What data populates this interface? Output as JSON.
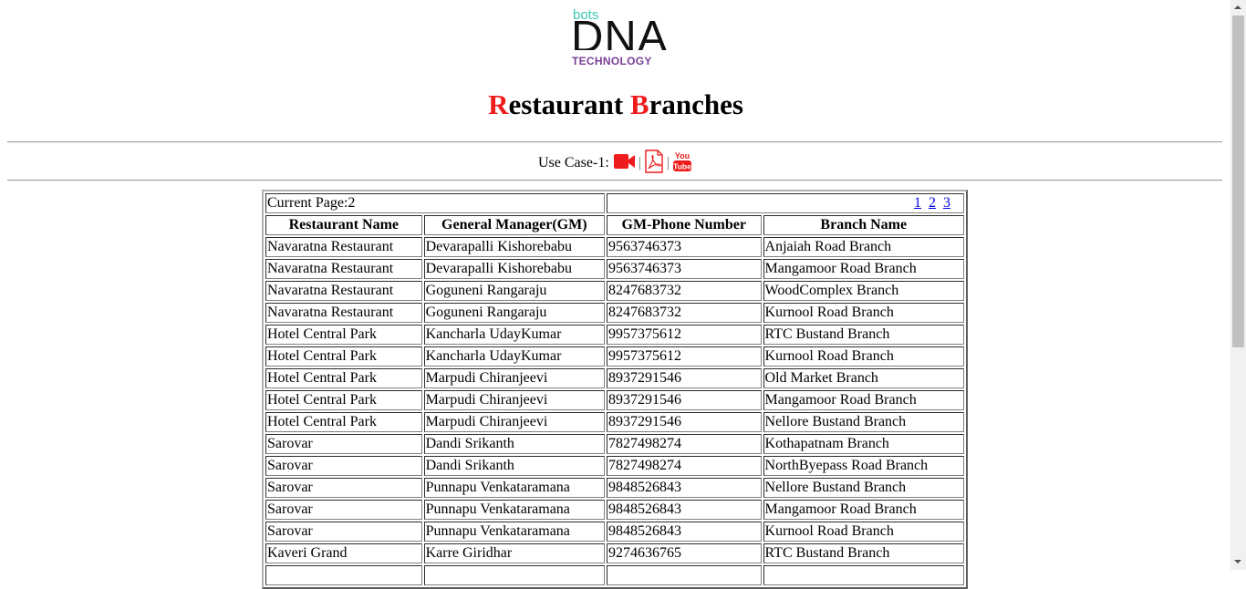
{
  "logo": {
    "top_text": "bots",
    "main_text": "DNA",
    "bottom_text": "TECHNOLOGY"
  },
  "page_title": {
    "first_cap": "R",
    "first_rest": "estaurant ",
    "second_cap": "B",
    "second_rest": "ranches"
  },
  "use_case": {
    "label": "Use Case-1:",
    "separator": "|",
    "icons": [
      "video-camera-icon",
      "pdf-document-icon",
      "youtube-icon"
    ],
    "youtube_text": {
      "top": "You",
      "bottom": "Tube"
    }
  },
  "colors": {
    "accent_red": "#ee1c1c",
    "link_blue": "#0000ee",
    "logo_teal": "#3cc7b4",
    "logo_purple": "#7a3e98"
  },
  "table": {
    "current_page_label": "Current Page:2",
    "pages": [
      "1",
      "2",
      "3"
    ],
    "headers": [
      "Restaurant Name",
      "General Manager(GM)",
      "GM-Phone Number",
      "Branch Name"
    ],
    "rows": [
      [
        "Navaratna Restaurant",
        "Devarapalli Kishorebabu",
        "9563746373",
        "Anjaiah Road Branch"
      ],
      [
        "Navaratna Restaurant",
        "Devarapalli Kishorebabu",
        "9563746373",
        "Mangamoor Road Branch"
      ],
      [
        "Navaratna Restaurant",
        "Goguneni Rangaraju",
        "8247683732",
        "WoodComplex Branch"
      ],
      [
        "Navaratna Restaurant",
        "Goguneni Rangaraju",
        "8247683732",
        "Kurnool Road Branch"
      ],
      [
        "Hotel Central Park",
        "Kancharla UdayKumar",
        "9957375612",
        "RTC Bustand Branch"
      ],
      [
        "Hotel Central Park",
        "Kancharla UdayKumar",
        "9957375612",
        "Kurnool Road Branch"
      ],
      [
        "Hotel Central Park",
        "Marpudi Chiranjeevi",
        "8937291546",
        "Old Market Branch"
      ],
      [
        "Hotel Central Park",
        "Marpudi Chiranjeevi",
        "8937291546",
        "Mangamoor Road Branch"
      ],
      [
        "Hotel Central Park",
        "Marpudi Chiranjeevi",
        "8937291546",
        "Nellore Bustand Branch"
      ],
      [
        "Sarovar",
        "Dandi Srikanth",
        "7827498274",
        "Kothapatnam Branch"
      ],
      [
        "Sarovar",
        "Dandi Srikanth",
        "7827498274",
        "NorthByepass Road Branch"
      ],
      [
        "Sarovar",
        "Punnapu Venkataramana",
        "9848526843",
        "Nellore Bustand Branch"
      ],
      [
        "Sarovar",
        "Punnapu Venkataramana",
        "9848526843",
        "Mangamoor Road Branch"
      ],
      [
        "Sarovar",
        "Punnapu Venkataramana",
        "9848526843",
        "Kurnool Road Branch"
      ],
      [
        "Kaveri Grand",
        "Karre Giridhar",
        "9274636765",
        "RTC Bustand Branch"
      ],
      [
        "",
        "",
        "",
        ""
      ]
    ]
  }
}
